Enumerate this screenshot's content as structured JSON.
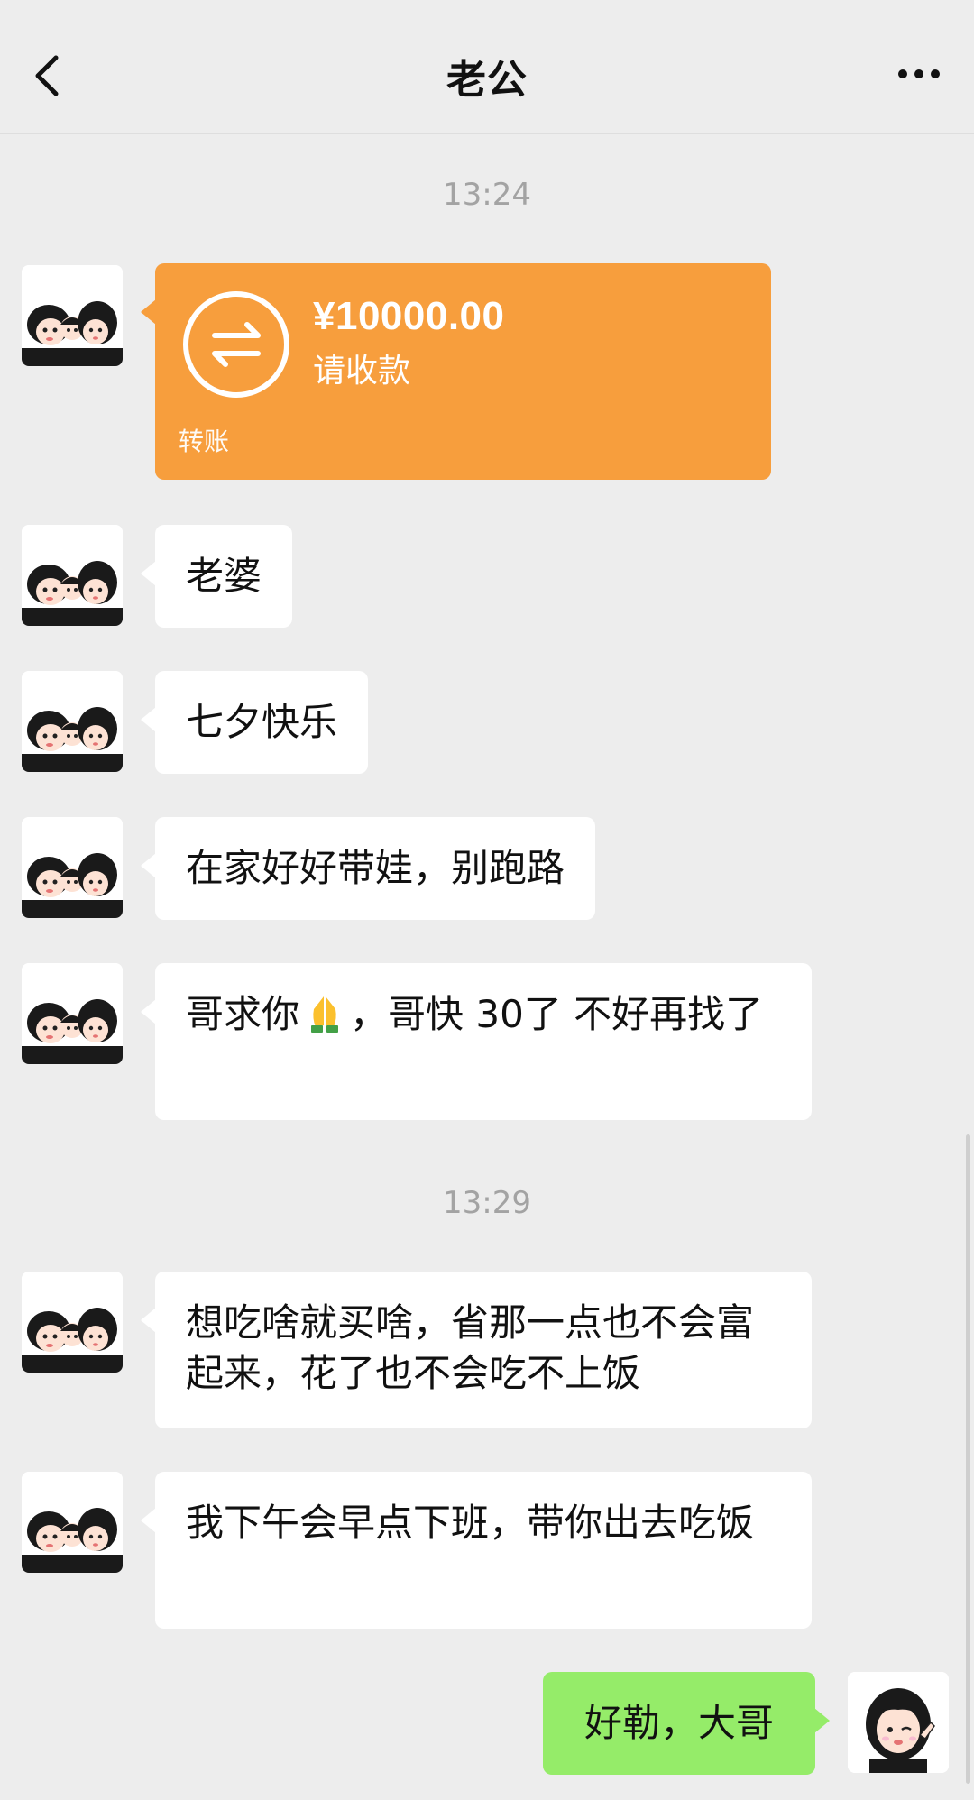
{
  "nav": {
    "title": "老公"
  },
  "messages": {
    "time_1": "13:24",
    "time_2": "13:29",
    "transfer": {
      "amount": "¥10000.00",
      "status": "请收款",
      "type": "转账",
      "color": "#f79e3d"
    },
    "m1": "老婆",
    "m2": "七夕快乐",
    "m3": "在家好好带娃，别跑路",
    "m4_before": "哥求你",
    "m4_emoji": "folded-hands",
    "m4_after": "，哥快 30了 不好再找了",
    "m5": "想吃啥就买啥，省那一点也不会富起来，花了也不会吃不上饭",
    "m6": "我下午会早点下班，带你出去吃饭",
    "reply": "好勒，大哥"
  },
  "colors": {
    "background": "#ededed",
    "incoming_bubble": "#ffffff",
    "outgoing_bubble": "#95ec69",
    "timestamp": "#a3a3a3"
  }
}
